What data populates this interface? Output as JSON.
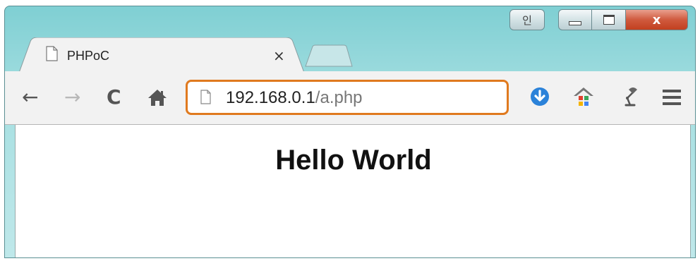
{
  "window": {
    "ime_label": "인",
    "close_glyph": "x"
  },
  "tab": {
    "title": "PHPoC",
    "close_glyph": "×"
  },
  "toolbar": {
    "back_glyph": "←",
    "forward_glyph": "→",
    "reload_glyph": "C",
    "home_glyph": "⌂",
    "url_host": "192.168.0.1",
    "url_path": "/a.php"
  },
  "page": {
    "heading": "Hello World"
  },
  "colors": {
    "omnibox_focus": "#e07a1f",
    "frame": "#a8e0e2",
    "download_icon": "#2b82d9"
  },
  "icons": [
    "page-icon",
    "download-icon",
    "home-app-icon",
    "lamp-icon",
    "menu-icon"
  ]
}
